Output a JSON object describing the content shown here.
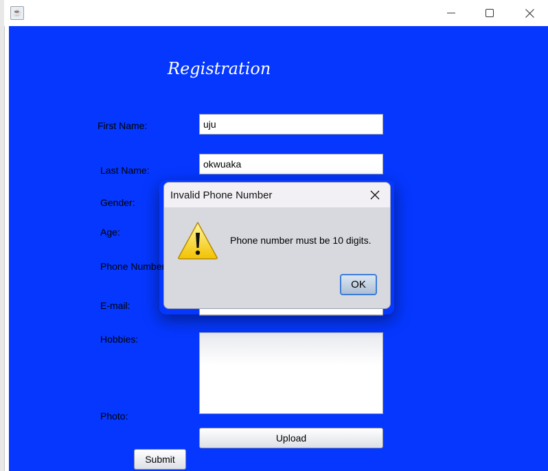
{
  "window": {
    "app_icon": "java-cup-icon",
    "minimize": "—",
    "maximize": "☐",
    "close": "✕"
  },
  "form": {
    "title": "Registration",
    "labels": {
      "first_name": "First Name:",
      "last_name": "Last Name:",
      "gender": "Gender:",
      "age": "Age:",
      "phone": "Phone Number:",
      "email": "E-mail:",
      "hobbies": "Hobbies:",
      "photo": "Photo:"
    },
    "values": {
      "first_name": "uju",
      "last_name": "okwuaka"
    },
    "upload_label": "Upload",
    "submit_label": "Submit"
  },
  "dialog": {
    "title": "Invalid Phone Number",
    "close": "✕",
    "message": "Phone number must be 10 digits.",
    "ok_label": "OK",
    "icon": "warning-icon"
  },
  "colors": {
    "background": "#0537ff",
    "dialog_bg": "#d7d9df"
  }
}
